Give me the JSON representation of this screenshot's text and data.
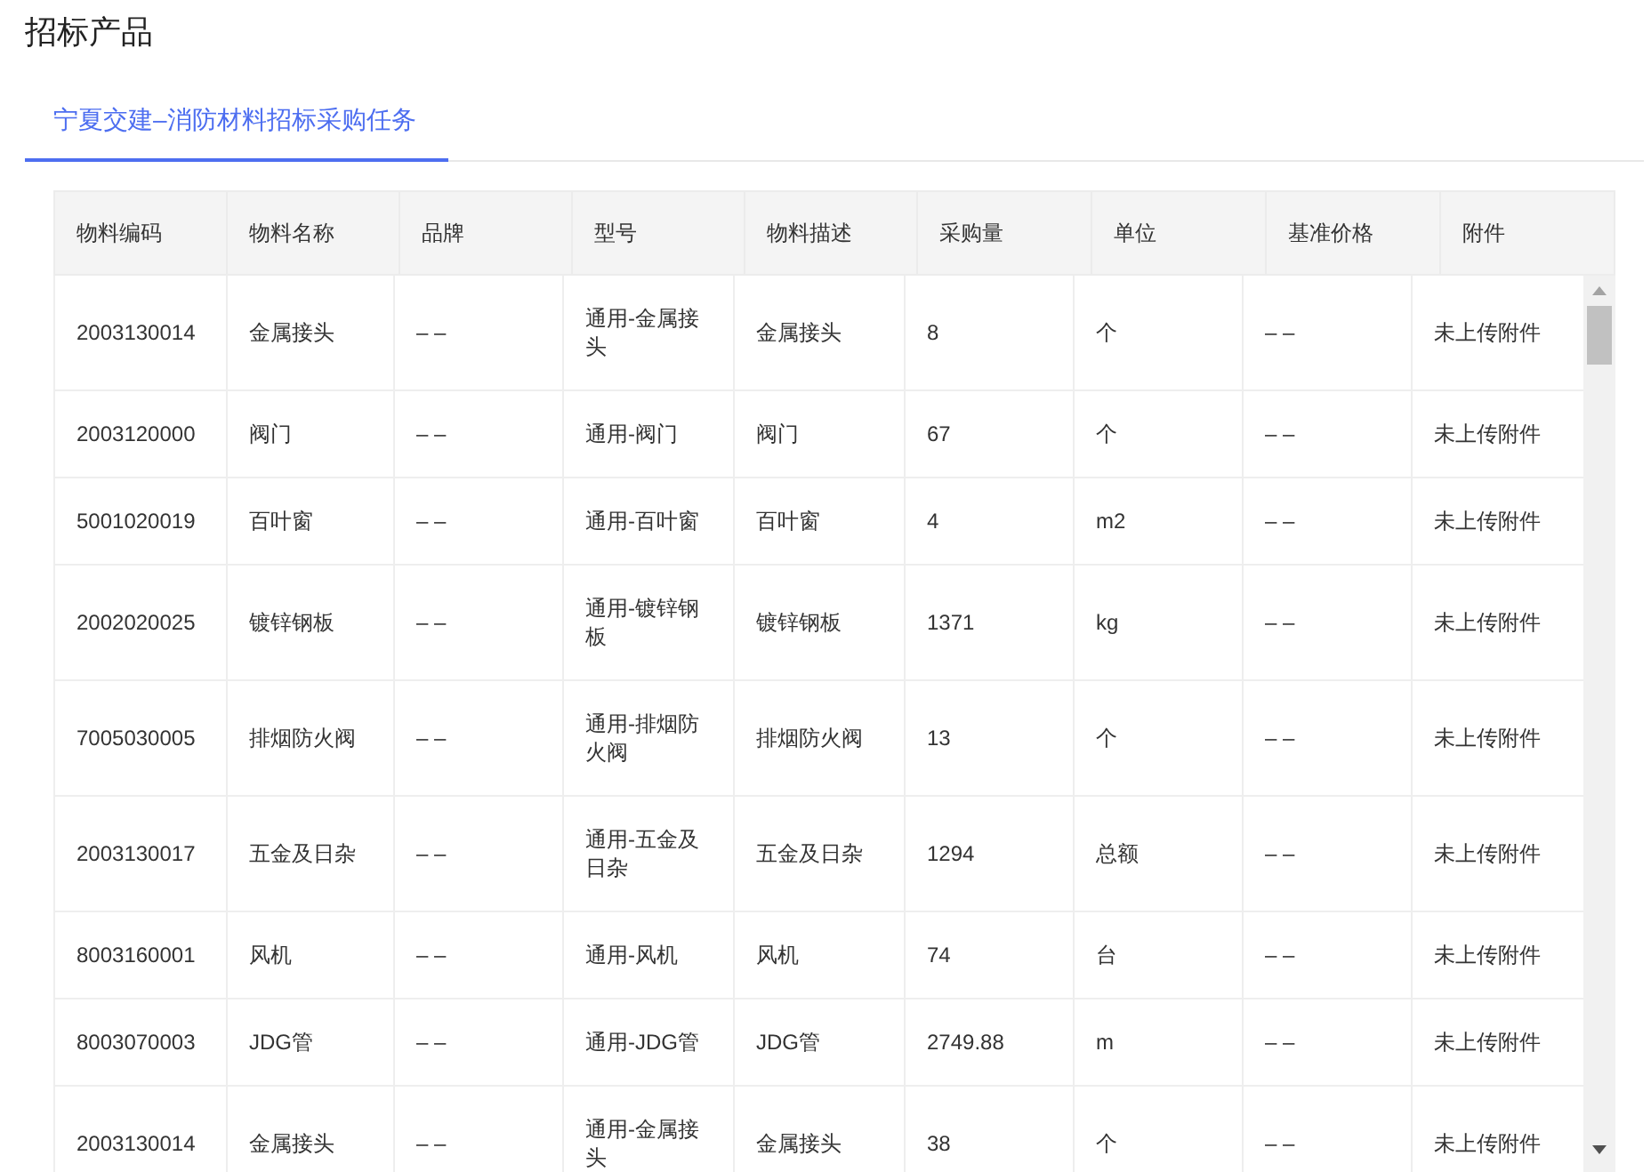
{
  "page_title": "招标产品",
  "tabs": [
    {
      "label": "宁夏交建–消防材料招标采购任务",
      "selected": true
    }
  ],
  "table": {
    "columns": [
      "物料编码",
      "物料名称",
      "品牌",
      "型号",
      "物料描述",
      "采购量",
      "单位",
      "基准价格",
      "附件"
    ],
    "rows": [
      [
        "2003130014",
        "金属接头",
        "– –",
        "通用-金属接头",
        "金属接头",
        "8",
        "个",
        "– –",
        "未上传附件"
      ],
      [
        "2003120000",
        "阀门",
        "– –",
        "通用-阀门",
        "阀门",
        "67",
        "个",
        "– –",
        "未上传附件"
      ],
      [
        "5001020019",
        "百叶窗",
        "– –",
        "通用-百叶窗",
        "百叶窗",
        "4",
        "m2",
        "– –",
        "未上传附件"
      ],
      [
        "2002020025",
        "镀锌钢板",
        "– –",
        "通用-镀锌钢板",
        "镀锌钢板",
        "1371",
        "kg",
        "– –",
        "未上传附件"
      ],
      [
        "7005030005",
        "排烟防火阀",
        "– –",
        "通用-排烟防火阀",
        "排烟防火阀",
        "13",
        "个",
        "– –",
        "未上传附件"
      ],
      [
        "2003130017",
        "五金及日杂",
        "– –",
        "通用-五金及日杂",
        "五金及日杂",
        "1294",
        "总额",
        "– –",
        "未上传附件"
      ],
      [
        "8003160001",
        "风机",
        "– –",
        "通用-风机",
        "风机",
        "74",
        "台",
        "– –",
        "未上传附件"
      ],
      [
        "8003070003",
        "JDG管",
        "– –",
        "通用-JDG管",
        "JDG管",
        "2749.88",
        "m",
        "– –",
        "未上传附件"
      ],
      [
        "2003130014",
        "金属接头",
        "– –",
        "通用-金属接头",
        "金属接头",
        "38",
        "个",
        "– –",
        "未上传附件"
      ]
    ]
  }
}
